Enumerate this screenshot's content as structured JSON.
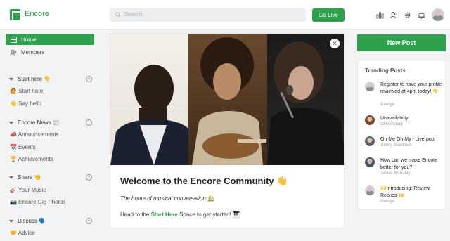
{
  "app": {
    "name": "Encore",
    "brand_color": "#2fa04d"
  },
  "header": {
    "search_placeholder": "Search",
    "go_live_label": "Go Live",
    "icons": [
      "chart-icon",
      "people-icon",
      "gear-icon",
      "bell-icon",
      "user-avatar"
    ]
  },
  "sidebar": {
    "home": "Home",
    "members": "Members",
    "sections": [
      {
        "title": "Start here 👇",
        "items": [
          "🙋 Start here",
          "👋 Say hello"
        ]
      },
      {
        "title": "Encore News 📰",
        "items": [
          "📣 Announcements",
          "📆 Events",
          "🏆 Achievements"
        ]
      },
      {
        "title": "Share 👏",
        "items": [
          "🎸 Your Music",
          "📷 Encore Gig Photos"
        ]
      },
      {
        "title": "Discuss 🗣️",
        "items": [
          "🤝 Advice"
        ]
      }
    ]
  },
  "main": {
    "title": "Welcome to the Encore Community 👋",
    "tagline": "The home of musical conversation 🏡",
    "cta_prefix": "Head to the ",
    "cta_link": "Start Here",
    "cta_suffix": " Space to get started! 🎹"
  },
  "right": {
    "new_post_label": "New Post",
    "trending_title": "Trending Posts",
    "posts": [
      {
        "title": "Register to have your profile reviewed at 4pm today! 👇",
        "author": "George"
      },
      {
        "title": "Unavailabilty",
        "author": "Chloé Chad"
      },
      {
        "title": "Oh Me Oh My - Liverpool",
        "author": "Jimmy Beedham"
      },
      {
        "title": "How can we make Encore better for you?",
        "author": "James McAulay"
      },
      {
        "title": "🙌Introducing: Review Replies 🙌",
        "author": "George"
      }
    ]
  }
}
